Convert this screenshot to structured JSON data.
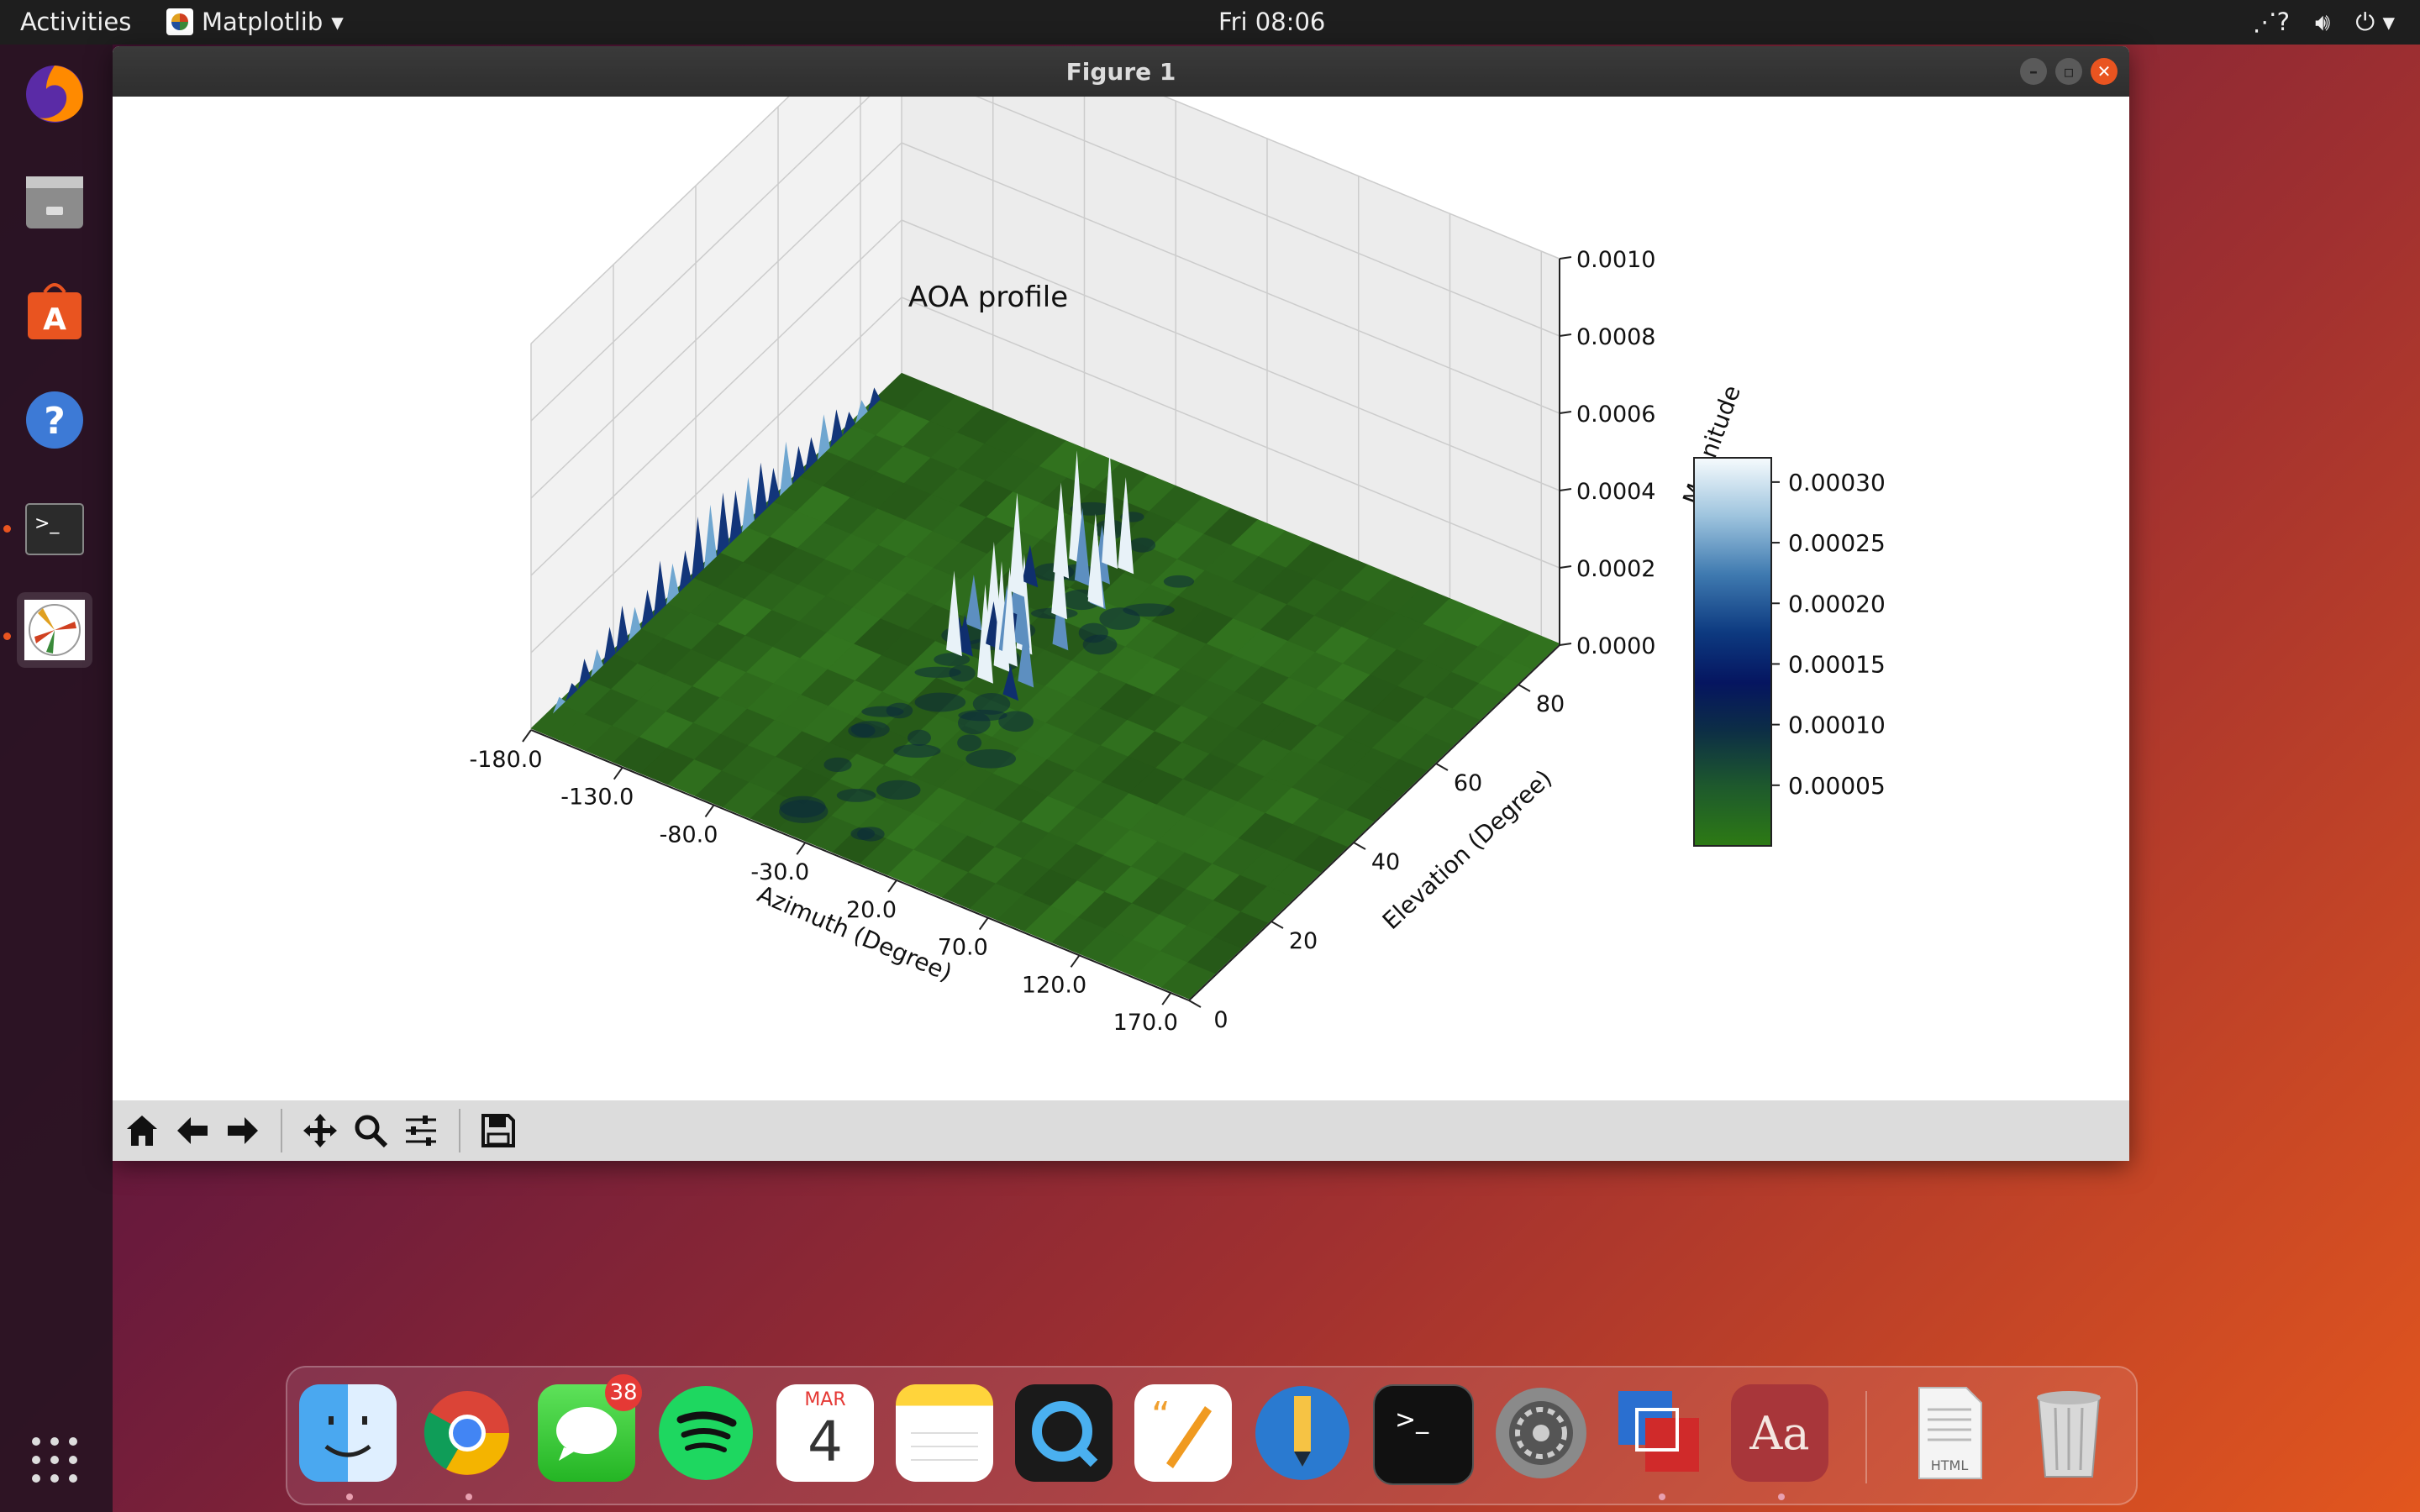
{
  "topbar": {
    "activities": "Activities",
    "app_menu": "Matplotlib",
    "clock": "Fri 08:06"
  },
  "window": {
    "title": "Figure 1"
  },
  "chart_data": {
    "type": "surface3d",
    "title": "AOA profile",
    "xlabel": "Azimuth (Degree)",
    "ylabel": "Elevation (Degree)",
    "zlabel": "Magnitude",
    "x_ticks": [
      "-180.0",
      "-130.0",
      "-80.0",
      "-30.0",
      "20.0",
      "70.0",
      "120.0",
      "170.0"
    ],
    "y_ticks": [
      "0",
      "20",
      "40",
      "60",
      "80"
    ],
    "z_ticks": [
      "0.0000",
      "0.0002",
      "0.0004",
      "0.0006",
      "0.0008",
      "0.0010"
    ],
    "xlim": [
      -180,
      180
    ],
    "ylim": [
      0,
      90
    ],
    "zlim": [
      0,
      0.001
    ],
    "colormap": "ocean-like (green low, navy mid, white high)",
    "colorbar_ticks": [
      "0.00030",
      "0.00025",
      "0.00020",
      "0.00015",
      "0.00010",
      "0.00005"
    ],
    "colorbar_range": [
      0,
      0.00032
    ],
    "peaks": [
      {
        "azimuth": -30,
        "elevation": 50,
        "magnitude": 0.0003
      },
      {
        "azimuth": -180,
        "elevation": 60,
        "magnitude": 0.00015
      }
    ],
    "colors": {
      "low": "#2d6a1c",
      "mid": "#0a1e5a",
      "high": "#ffffff"
    }
  },
  "toolbar": {
    "buttons": [
      "home-icon",
      "back-icon",
      "forward-icon",
      "pan-icon",
      "zoom-icon",
      "configure-icon",
      "save-icon"
    ]
  },
  "dock": {
    "messages_badge": "38",
    "calendar_month": "MAR",
    "calendar_day": "4",
    "dictionary_label": "Aa",
    "file_label": "HTML"
  }
}
